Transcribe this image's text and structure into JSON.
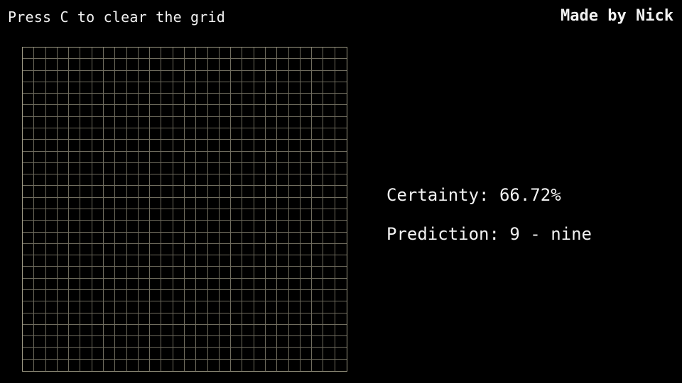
{
  "header": {
    "hint": "Press C to clear the grid",
    "credit": "Made by Nick"
  },
  "grid": {
    "rows": 28,
    "cols": 28,
    "line_color": "#6f6c5e",
    "background": "#000000"
  },
  "result": {
    "certainty_label": "Certainty:",
    "certainty_value": "66.72%",
    "prediction_label": "Prediction:",
    "prediction_value": "9 - nine"
  }
}
